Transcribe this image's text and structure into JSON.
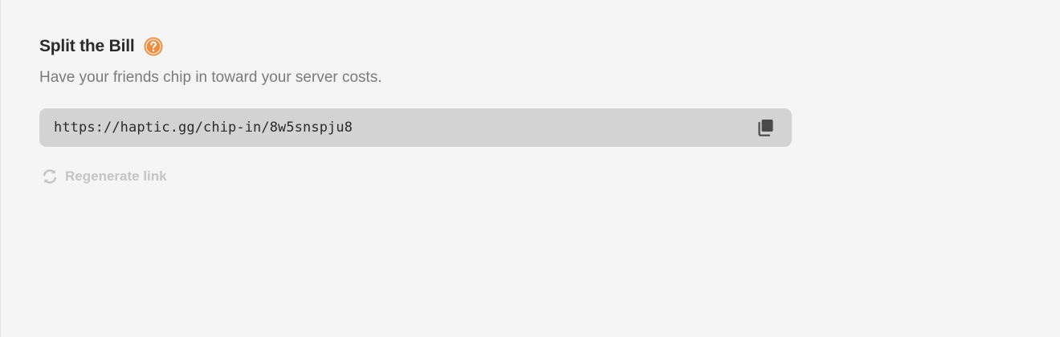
{
  "section": {
    "title": "Split the Bill",
    "subtitle": "Have your friends chip in toward your server costs.",
    "help_icon": "question-circle-icon"
  },
  "share_link": {
    "url": "https://haptic.gg/chip-in/8w5snspju8",
    "copy_icon": "copy-icon"
  },
  "regenerate": {
    "label": "Regenerate link",
    "icon": "refresh-icon"
  },
  "colors": {
    "background": "#f5f5f5",
    "accent": "#f08a3c",
    "link_box": "#d3d3d3",
    "title": "#2a2a2a",
    "subtitle": "#7a7a7a",
    "disabled": "#c4c4c4",
    "copy_icon": "#4a4a4a"
  }
}
